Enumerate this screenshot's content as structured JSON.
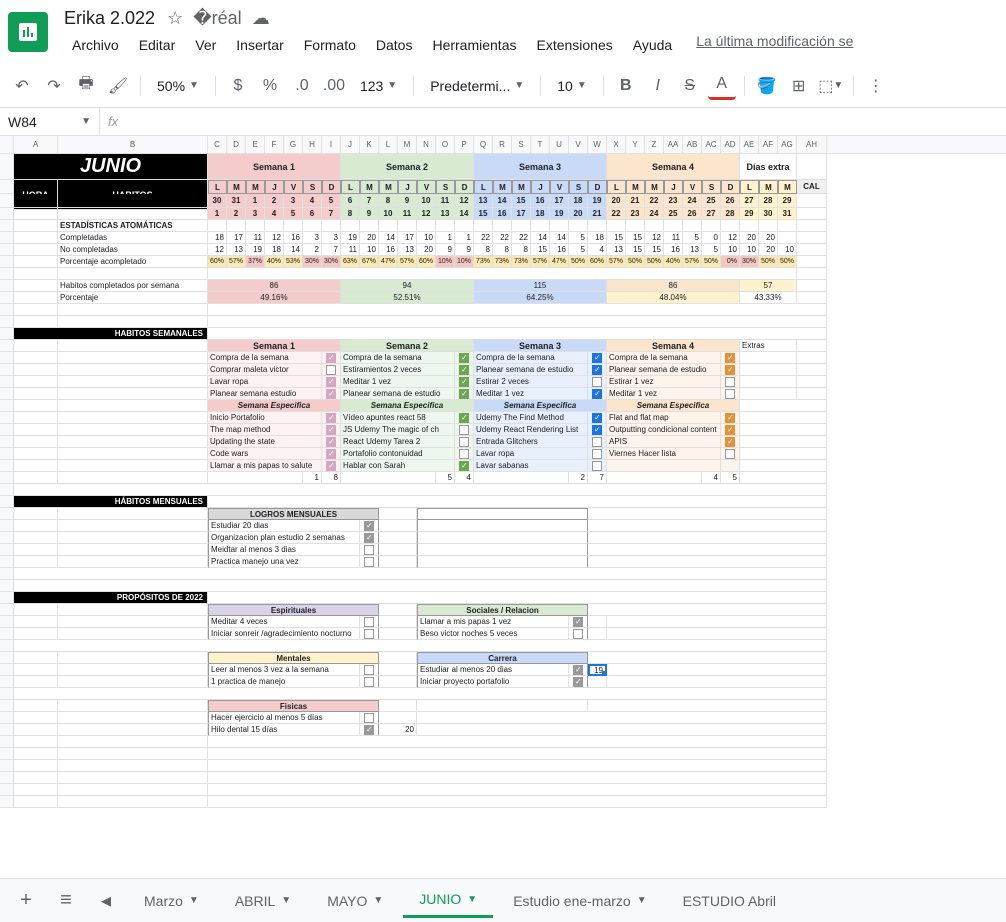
{
  "docTitle": "Erika 2.022",
  "menus": [
    "Archivo",
    "Editar",
    "Ver",
    "Insertar",
    "Formato",
    "Datos",
    "Herramientas",
    "Extensiones",
    "Ayuda"
  ],
  "lastMod": "La última modificación se",
  "toolbar": {
    "zoom": "50%",
    "font": "Predetermi...",
    "size": "10",
    "fmt": "123"
  },
  "cellRef": "W84",
  "monthTitle": "JUNIO",
  "hora": "HORA",
  "habitos": "HABITOS",
  "cal": "CAL",
  "weeks": [
    "Semana 1",
    "Semana 2",
    "Semana 3",
    "Semana 4",
    "Días extra"
  ],
  "dayLetters": [
    "L",
    "M",
    "M",
    "J",
    "V",
    "S",
    "D"
  ],
  "weekDates": {
    "w1": [
      "30",
      "31",
      "1",
      "2",
      "3",
      "4",
      "5"
    ],
    "w2": [
      "6",
      "7",
      "8",
      "9",
      "10",
      "11",
      "12"
    ],
    "w3": [
      "13",
      "14",
      "15",
      "16",
      "17",
      "18",
      "19"
    ],
    "w4": [
      "20",
      "21",
      "22",
      "23",
      "24",
      "25",
      "26"
    ],
    "extra": [
      "27",
      "28",
      "29"
    ]
  },
  "weekNums": {
    "w1": [
      "1",
      "2",
      "3",
      "4",
      "5",
      "6",
      "7"
    ],
    "w2": [
      "8",
      "9",
      "10",
      "11",
      "12",
      "13",
      "14"
    ],
    "w3": [
      "15",
      "16",
      "17",
      "18",
      "19",
      "20",
      "21"
    ],
    "w4": [
      "22",
      "23",
      "24",
      "25",
      "26",
      "27",
      "28"
    ],
    "extra": [
      "29",
      "30",
      "31"
    ]
  },
  "sections": {
    "stats": "ESTADÍSTICAS ATOMÁTICAS",
    "completadas": "Completadas",
    "noComp": "No completadas",
    "pct": "Porcentaje acompletado",
    "habSem": "Habitos completados por semana",
    "porcentaje": "Porcentaje",
    "habSemanales": "HABITOS SEMANALES",
    "habMensuales": "HÁBITOS MENSUALES",
    "propositos": "PROPÓSITOS DE 2022",
    "logros": "LOGROS MENSUALES",
    "semEspec": "Semana Especifica",
    "extras": "Extras"
  },
  "stats": {
    "completadas": [
      "18",
      "17",
      "11",
      "12",
      "16",
      "3",
      "3",
      "19",
      "20",
      "14",
      "17",
      "10",
      "1",
      "1",
      "22",
      "22",
      "22",
      "14",
      "14",
      "5",
      "18",
      "15",
      "15",
      "12",
      "11",
      "5",
      "0",
      "12",
      "20",
      "20"
    ],
    "noComp": [
      "12",
      "13",
      "19",
      "18",
      "14",
      "2",
      "7",
      "11",
      "10",
      "16",
      "13",
      "20",
      "9",
      "9",
      "8",
      "8",
      "8",
      "15",
      "16",
      "5",
      "4",
      "13",
      "15",
      "15",
      "16",
      "13",
      "5",
      "10",
      "10",
      "20",
      "10"
    ],
    "pct": [
      "60%",
      "57%",
      "37%",
      "40%",
      "53%",
      "30%",
      "30%",
      "63%",
      "67%",
      "47%",
      "57%",
      "60%",
      "10%",
      "10%",
      "73%",
      "73%",
      "73%",
      "57%",
      "47%",
      "50%",
      "60%",
      "57%",
      "50%",
      "50%",
      "40%",
      "57%",
      "50%",
      "0%",
      "30%",
      "50%",
      "50%"
    ]
  },
  "weekStats": {
    "counts": [
      "86",
      "94",
      "115",
      "86",
      "57"
    ],
    "pcts": [
      "49.16%",
      "52.51%",
      "64.25%",
      "48.04%",
      "43.33%"
    ]
  },
  "weeklyHabits": {
    "w1": [
      {
        "t": "Compra de la semana",
        "c": true
      },
      {
        "t": "Comprar maleta victor",
        "c": false
      },
      {
        "t": "Lavar ropa",
        "c": true
      },
      {
        "t": "Planear semana estudio",
        "c": true
      }
    ],
    "w2": [
      {
        "t": "Compra de la semana",
        "c": true
      },
      {
        "t": "Estiramientos 2 veces",
        "c": true
      },
      {
        "t": "Meditar 1 vez",
        "c": true
      },
      {
        "t": "Planear semana de estudio",
        "c": true
      }
    ],
    "w3": [
      {
        "t": "Compra de la semana",
        "c": true
      },
      {
        "t": "Planear semana de estudio",
        "c": true
      },
      {
        "t": "Estirar 2 veces",
        "c": false
      },
      {
        "t": "Meditar 1 vez",
        "c": true
      }
    ],
    "w4": [
      {
        "t": "Compra de la semana",
        "c": true
      },
      {
        "t": "Planear semana de estudio",
        "c": true
      },
      {
        "t": "Estirar 1 vez",
        "c": false
      },
      {
        "t": "Meditar 1 vez",
        "c": false
      }
    ]
  },
  "weeklySpecific": {
    "w1": [
      {
        "t": "Inicio Portafolio",
        "c": true
      },
      {
        "t": "The map method",
        "c": true
      },
      {
        "t": "Updating the state",
        "c": true
      },
      {
        "t": "Code wars",
        "c": true
      },
      {
        "t": "Llamar a mis papas to salute",
        "c": true
      }
    ],
    "w2": [
      {
        "t": "Vídeo apuntes react 58",
        "c": true
      },
      {
        "t": "JS Udemy The magic of ch",
        "c": false
      },
      {
        "t": "React Udemy Tarea 2",
        "c": false
      },
      {
        "t": "Portafolio contonuidad",
        "c": false
      },
      {
        "t": "Hablar con Sarah",
        "c": true
      }
    ],
    "w3": [
      {
        "t": "Udemy The Find Method",
        "c": true
      },
      {
        "t": "Udemy React Rendering List",
        "c": true
      },
      {
        "t": "Entrada Glitchers",
        "c": false
      },
      {
        "t": "Lavar ropa",
        "c": false
      },
      {
        "t": "Lavar sabanas",
        "c": false
      }
    ],
    "w4": [
      {
        "t": "Flat and flat map",
        "c": true
      },
      {
        "t": "Outputting condicional content",
        "c": true
      },
      {
        "t": "APIS",
        "c": true
      },
      {
        "t": "Viernes Hacer lista",
        "c": false
      }
    ]
  },
  "bottomNums": {
    "c1": "1",
    "c2": "8",
    "c3": "5",
    "c4": "4",
    "c5": "2",
    "c6": "7",
    "c7": "4",
    "c8": "5"
  },
  "logros": [
    {
      "t": "Estudiar 20 dias",
      "c": true
    },
    {
      "t": "Organizacion plan estudio 2 semanas",
      "c": true
    },
    {
      "t": "Meidtar al menos 3 dias",
      "c": false
    },
    {
      "t": "Practica manejo una vez",
      "c": false
    }
  ],
  "propositos": {
    "espirituales": {
      "title": "Espirituales",
      "items": [
        {
          "t": "Meditar 4 veces",
          "c": false
        },
        {
          "t": "Iniciar sonreir /agradecimiento nocturno",
          "c": false
        }
      ]
    },
    "sociales": {
      "title": "Sociales / Relacion",
      "items": [
        {
          "t": "Llamar a mis papas 1 vez",
          "c": true
        },
        {
          "t": "Beso victor noches 5 veces",
          "c": false
        }
      ]
    },
    "mentales": {
      "title": "Mentales",
      "items": [
        {
          "t": "Leer al menos 3 vez a la semana",
          "c": false
        },
        {
          "t": "1 practica de manejo",
          "c": false
        }
      ]
    },
    "carrera": {
      "title": "Carrera",
      "items": [
        {
          "t": "Estudiar al menos 20 dias",
          "c": true
        },
        {
          "t": "Iniciar proyecto portafolio",
          "c": true
        }
      ],
      "extra": "19"
    },
    "fisicas": {
      "title": "Fisicas",
      "items": [
        {
          "t": "Hacer ejercicio al menos 5 días",
          "c": false
        },
        {
          "t": "Hilo dental 15 días",
          "c": true
        }
      ],
      "extra": "20"
    }
  },
  "tabs": [
    "Marzo",
    "ABRIL",
    "MAYO",
    "JUNIO",
    "Estudio ene-marzo",
    "ESTUDIO Abril"
  ],
  "activeTab": "JUNIO"
}
